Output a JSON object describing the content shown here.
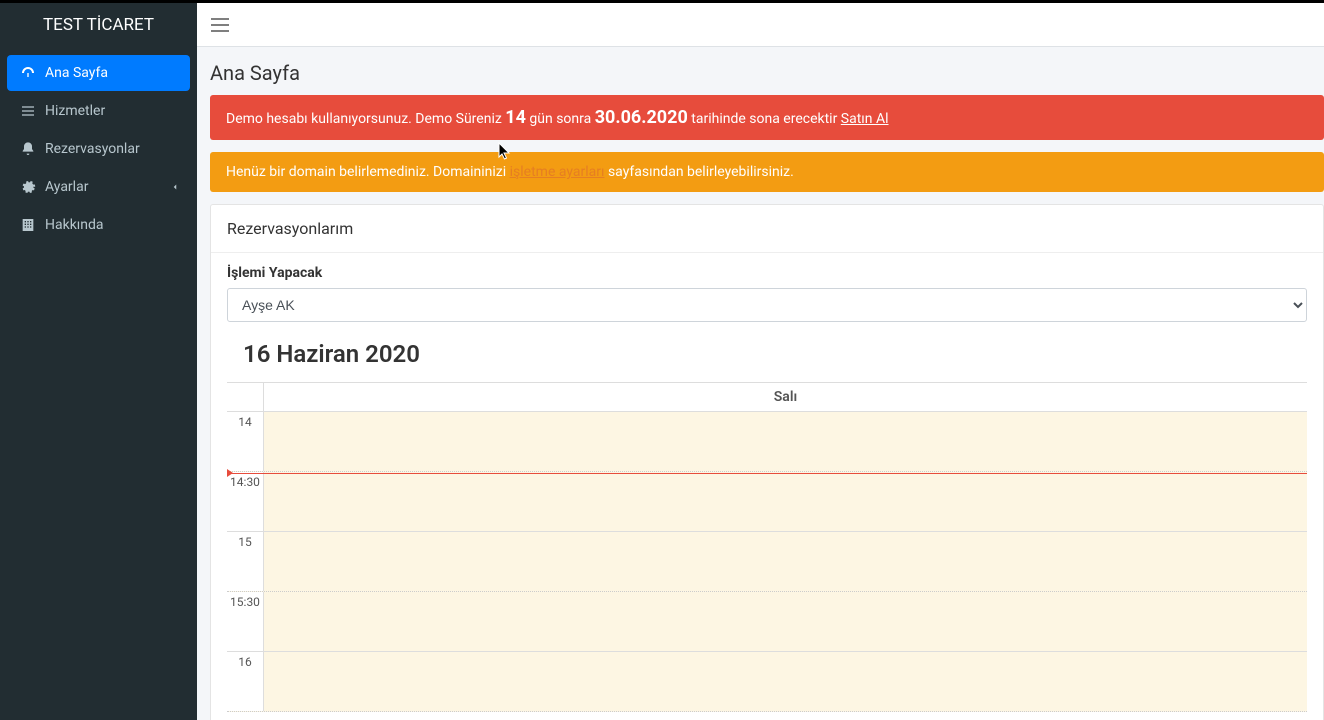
{
  "brand": "TEST TİCARET",
  "sidebar": {
    "items": [
      {
        "label": "Ana Sayfa",
        "icon": "dashboard-icon"
      },
      {
        "label": "Hizmetler",
        "icon": "list-icon"
      },
      {
        "label": "Rezervasyonlar",
        "icon": "bell-icon"
      },
      {
        "label": "Ayarlar",
        "icon": "gear-icon",
        "has_children": true
      },
      {
        "label": "Hakkında",
        "icon": "building-icon"
      }
    ]
  },
  "page_title": "Ana Sayfa",
  "alert_danger": {
    "pre": "Demo hesabı kullanıyorsunuz. Demo Süreniz ",
    "days": "14",
    "mid": " gün sonra ",
    "date": "30.06.2020",
    "post": " tarihinde sona erecektir ",
    "link": "Satın Al"
  },
  "alert_warning": {
    "pre": "Henüz bir domain belirlemediniz. Domaininizi ",
    "link": "işletme ayarları",
    "post": " sayfasından belirleyebilirsiniz."
  },
  "reservations": {
    "title": "Rezervasyonlarım",
    "operator_label": "İşlemi Yapacak",
    "operator_value": "Ayşe AK",
    "calendar_date": "16 Haziran 2020",
    "day_label": "Salı",
    "time_slots": [
      "14",
      "14:30",
      "15",
      "15:30",
      "16"
    ]
  }
}
